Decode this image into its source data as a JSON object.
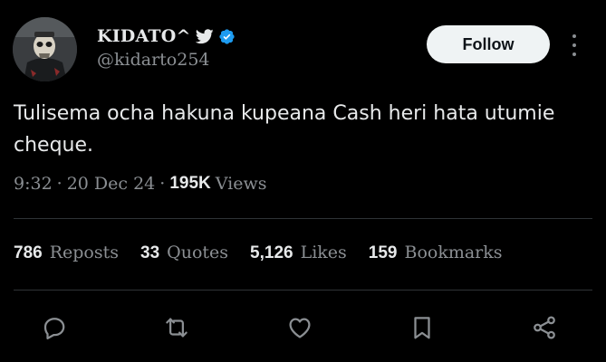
{
  "author": {
    "display_name": "KIDATO^",
    "handle": "@kidarto254",
    "avatar": "avatar-skull-image",
    "badges": [
      "bird-icon",
      "verified-icon"
    ],
    "verified_color": "#1d9bf0"
  },
  "follow_label": "Follow",
  "tweet": {
    "text": "Tulisema ocha hakuna kupeana Cash heri hata utumie cheque.",
    "time": "9:32",
    "date": "20 Dec 24",
    "views_count": "195K",
    "views_label": "Views"
  },
  "stats": [
    {
      "count": "786",
      "label": "Reposts"
    },
    {
      "count": "33",
      "label": "Quotes"
    },
    {
      "count": "5,126",
      "label": "Likes"
    },
    {
      "count": "159",
      "label": "Bookmarks"
    }
  ],
  "actions": [
    "reply-icon",
    "repost-icon",
    "like-icon",
    "bookmark-icon",
    "share-icon"
  ],
  "colors": {
    "background": "#000000",
    "text": "#e7e9ea",
    "secondary_text": "#8b8f93",
    "divider": "#2f3336",
    "follow_button_bg": "#eff3f4",
    "follow_button_text": "#0f1419"
  }
}
